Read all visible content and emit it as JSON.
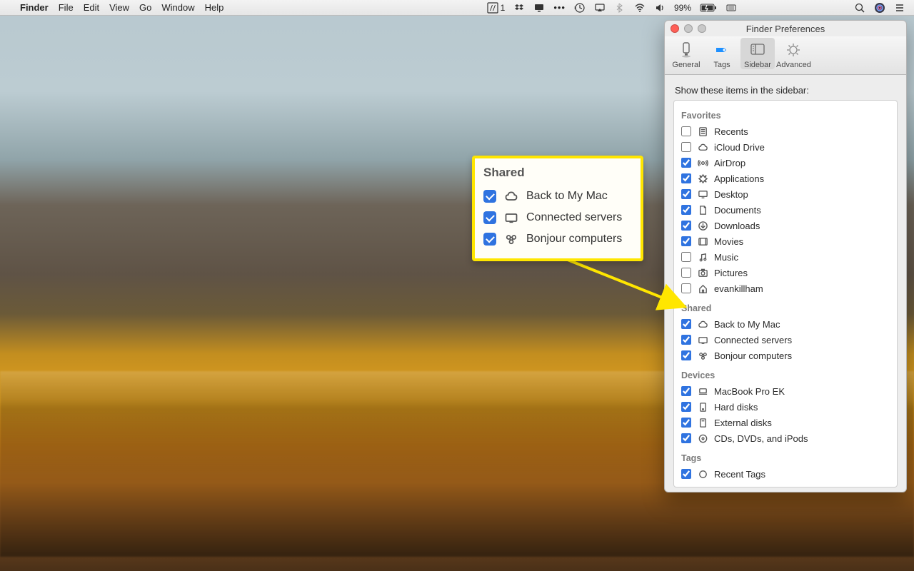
{
  "menubar": {
    "app": "Finder",
    "items": [
      "File",
      "Edit",
      "View",
      "Go",
      "Window",
      "Help"
    ],
    "adobe_badge": "1",
    "battery_text": "99%"
  },
  "window": {
    "title": "Finder Preferences",
    "tabs": {
      "general": "General",
      "tags": "Tags",
      "sidebar": "Sidebar",
      "advanced": "Advanced"
    },
    "heading": "Show these items in the sidebar:",
    "sections": {
      "favorites": {
        "title": "Favorites",
        "items": [
          {
            "label": "Recents",
            "checked": false,
            "icon": "recents"
          },
          {
            "label": "iCloud Drive",
            "checked": false,
            "icon": "cloud"
          },
          {
            "label": "AirDrop",
            "checked": true,
            "icon": "airdrop"
          },
          {
            "label": "Applications",
            "checked": true,
            "icon": "apps"
          },
          {
            "label": "Desktop",
            "checked": true,
            "icon": "desktop"
          },
          {
            "label": "Documents",
            "checked": true,
            "icon": "documents"
          },
          {
            "label": "Downloads",
            "checked": true,
            "icon": "downloads"
          },
          {
            "label": "Movies",
            "checked": true,
            "icon": "movies"
          },
          {
            "label": "Music",
            "checked": false,
            "icon": "music"
          },
          {
            "label": "Pictures",
            "checked": false,
            "icon": "pictures"
          },
          {
            "label": "evankillham",
            "checked": false,
            "icon": "home"
          }
        ]
      },
      "shared": {
        "title": "Shared",
        "items": [
          {
            "label": "Back to My Mac",
            "checked": true,
            "icon": "cloud"
          },
          {
            "label": "Connected servers",
            "checked": true,
            "icon": "server"
          },
          {
            "label": "Bonjour computers",
            "checked": true,
            "icon": "bonjour"
          }
        ]
      },
      "devices": {
        "title": "Devices",
        "items": [
          {
            "label": "MacBook Pro EK",
            "checked": true,
            "icon": "laptop"
          },
          {
            "label": "Hard disks",
            "checked": true,
            "icon": "hdd"
          },
          {
            "label": "External disks",
            "checked": true,
            "icon": "extdisk"
          },
          {
            "label": "CDs, DVDs, and iPods",
            "checked": true,
            "icon": "cd"
          }
        ]
      },
      "tags": {
        "title": "Tags",
        "items": [
          {
            "label": "Recent Tags",
            "checked": true,
            "icon": "tag"
          }
        ]
      }
    }
  },
  "callout": {
    "title": "Shared",
    "items": [
      {
        "label": "Back to My Mac",
        "icon": "cloud"
      },
      {
        "label": "Connected servers",
        "icon": "server"
      },
      {
        "label": "Bonjour computers",
        "icon": "bonjour"
      }
    ]
  }
}
